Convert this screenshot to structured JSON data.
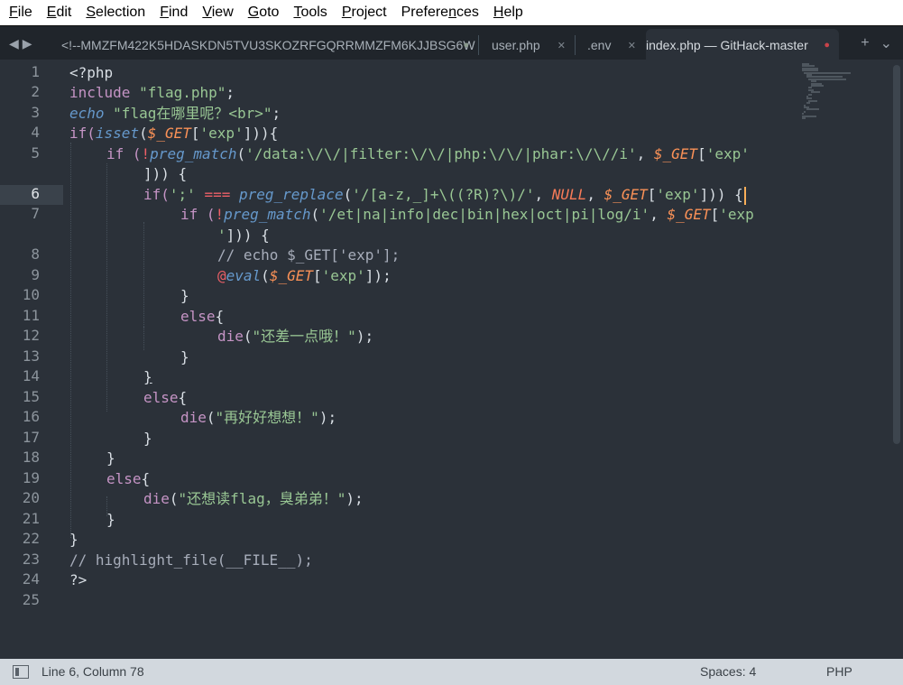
{
  "menu": [
    {
      "label": "File",
      "acc": "F",
      "rest": "ile"
    },
    {
      "label": "Edit",
      "acc": "E",
      "rest": "dit"
    },
    {
      "label": "Selection",
      "acc": "S",
      "rest": "election"
    },
    {
      "label": "Find",
      "acc": "F",
      "rest": "ind",
      "pre": ""
    },
    {
      "label": "View",
      "acc": "V",
      "rest": "iew"
    },
    {
      "label": "Goto",
      "acc": "G",
      "rest": "oto"
    },
    {
      "label": "Tools",
      "acc": "T",
      "rest": "ools"
    },
    {
      "label": "Project",
      "acc": "P",
      "rest": "roject"
    },
    {
      "label": "Preferences",
      "pre": "Prefere",
      "acc": "n",
      "rest": "ces"
    },
    {
      "label": "Help",
      "acc": "H",
      "rest": "elp"
    }
  ],
  "nav": {
    "back_icon": "triangle-left-icon",
    "forward_icon": "triangle-right-icon"
  },
  "tabs": [
    {
      "title": "<!--MMZFM422K5HDASKDN5TVU3SKOZRFGQRRMMZFM6KJJBSG6W",
      "status": "●",
      "status_color": "#8a9a8e"
    },
    {
      "title": "user.php",
      "status": "✕",
      "status_color": "#7d858d"
    },
    {
      "title": ".env",
      "status": "✕",
      "status_color": "#7d858d"
    },
    {
      "title": "index.php — GitHack-master",
      "status": "●",
      "status_color": "#c9434a"
    }
  ],
  "tab_actions": {
    "add": "+",
    "more": "⌄"
  },
  "editor": {
    "current_line": 6,
    "line_numbers": [
      "1",
      "2",
      "3",
      "4",
      "5",
      "",
      "6",
      "7",
      "",
      "8",
      "9",
      "10",
      "11",
      "12",
      "13",
      "14",
      "15",
      "16",
      "17",
      "18",
      "19",
      "20",
      "21",
      "22",
      "23",
      "24",
      "25"
    ]
  },
  "code": {
    "l1": "<?php",
    "l2_kw": "include",
    "l2_str": "\"flag.php\"",
    "l2_end": ";",
    "l3_kw": "echo",
    "l3_str": "\"flag在哪里呢？<br>\"",
    "l3_end": ";",
    "l4_a": "if(",
    "l4_fn": "isset",
    "l4_b": "(",
    "l4_var": "$_GET",
    "l4_c": "[",
    "l4_str": "'exp'",
    "l4_d": "])){",
    "l5_a": "if (",
    "l5_bang": "!",
    "l5_fn": "preg_match",
    "l5_b": "(",
    "l5_str": "'/data:\\/\\/|filter:\\/\\/|php:\\/\\/|phar:\\/\\//i'",
    "l5_c": ", ",
    "l5_var": "$_GET",
    "l5_d": "[",
    "l5_str2": "'exp'",
    "l5_wrap": "])) {",
    "l6_a": "if(",
    "l6_str": "';'",
    "l6_op": " === ",
    "l6_fn": "preg_replace",
    "l6_b": "(",
    "l6_str2": "'/[a-z,_]+\\((?R)?\\)/'",
    "l6_c": ", ",
    "l6_null": "NULL",
    "l6_d": ", ",
    "l6_var": "$_GET",
    "l6_e": "[",
    "l6_str3": "'exp'",
    "l6_f": "])) {",
    "l7_a": "if (",
    "l7_bang": "!",
    "l7_fn": "preg_match",
    "l7_b": "(",
    "l7_str": "'/et|na|info|dec|bin|hex|oct|pi|log/i'",
    "l7_c": ", ",
    "l7_var": "$_GET",
    "l7_d": "[",
    "l7_str2": "'exp",
    "l7_wrap_str": "'",
    "l7_wrap": "])) {",
    "l8": "// echo $_GET['exp'];",
    "l9_at": "@",
    "l9_fn": "eval",
    "l9_a": "(",
    "l9_var": "$_GET",
    "l9_b": "[",
    "l9_str": "'exp'",
    "l9_c": "]);",
    "l10": "}",
    "l11_kw": "else",
    "l11_b": "{",
    "l12_kw": "die",
    "l12_a": "(",
    "l12_str": "\"还差一点哦！\"",
    "l12_b": ");",
    "l13": "}",
    "l14": "}",
    "l15_kw": "else",
    "l15_b": "{",
    "l16_kw": "die",
    "l16_a": "(",
    "l16_str": "\"再好好想想！\"",
    "l16_b": ");",
    "l17": "}",
    "l18": "}",
    "l19_kw": "else",
    "l19_b": "{",
    "l20_kw": "die",
    "l20_a": "(",
    "l20_str": "\"还想读flag，臭弟弟！\"",
    "l20_b": ");",
    "l21": "}",
    "l22": "}",
    "l23": "// highlight_file(__FILE__);",
    "l24": "?>"
  },
  "status": {
    "position": "Line 6, Column 78",
    "spaces": "Spaces: 4",
    "syntax": "PHP",
    "panel_icon": "panel-toggle-icon"
  }
}
